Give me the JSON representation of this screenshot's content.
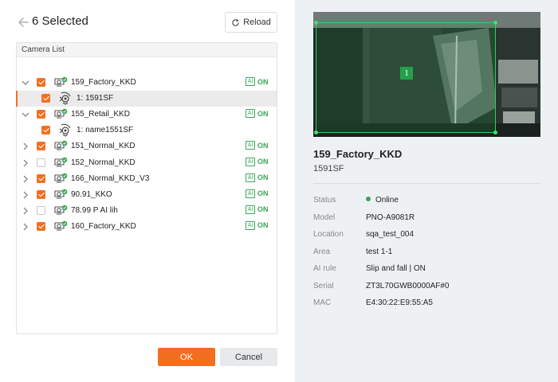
{
  "header": {
    "title": "6 Selected",
    "reload_label": "Reload"
  },
  "list": {
    "header_label": "Camera List",
    "rows": [
      {
        "label": "159_Factory_KKD",
        "ai_badge": "AI",
        "ai_status": "ON",
        "checked": true,
        "expanded": true
      },
      {
        "label": "1: 1591SF",
        "checked": true,
        "selected": true
      },
      {
        "label": "155_Retail_KKD",
        "ai_badge": "AI",
        "ai_status": "ON",
        "checked": true,
        "expanded": true
      },
      {
        "label": "1: name1551SF",
        "checked": true
      },
      {
        "label": "151_Normal_KKD",
        "ai_badge": "AI",
        "ai_status": "ON",
        "checked": true
      },
      {
        "label": "152_Normal_KKD",
        "ai_badge": "AI",
        "ai_status": "ON",
        "checked": false
      },
      {
        "label": "166_Normal_KKD_V3",
        "ai_badge": "AI",
        "ai_status": "ON",
        "checked": true
      },
      {
        "label": "90.91_KKO",
        "ai_badge": "AI",
        "ai_status": "ON",
        "checked": true
      },
      {
        "label": "78.99 P AI lih",
        "ai_badge": "AI",
        "ai_status": "ON",
        "checked": false
      },
      {
        "label": "160_Factory_KKD",
        "ai_badge": "AI",
        "ai_status": "ON",
        "checked": true
      }
    ]
  },
  "footer": {
    "ok_label": "OK",
    "cancel_label": "Cancel"
  },
  "detail": {
    "roi_number": "1",
    "camera_name": "159_Factory_KKD",
    "channel_name": "1591SF",
    "fields": [
      {
        "label": "Status",
        "value": "Online"
      },
      {
        "label": "Model",
        "value": "PNO-A9081R"
      },
      {
        "label": "Location",
        "value": "sqa_test_004"
      },
      {
        "label": "Area",
        "value": "test 1-1"
      },
      {
        "label": "AI rule",
        "value": "Slip and fall | ON"
      },
      {
        "label": "Serial",
        "value": "ZT3L70GWB0000AF#0"
      },
      {
        "label": "MAC",
        "value": "E4:30:22:E9:55:A5"
      }
    ]
  },
  "colors": {
    "accent": "#f26f21",
    "ai_green": "#3aa757",
    "online": "#3aa757"
  }
}
